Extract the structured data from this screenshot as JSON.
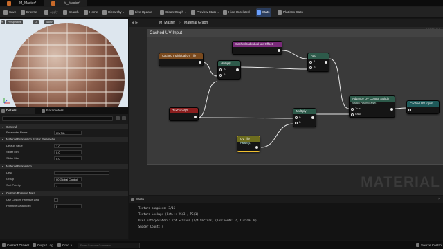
{
  "tabs": [
    {
      "label": "M_Master*",
      "active": false
    },
    {
      "label": "M_Master*",
      "active": true
    }
  ],
  "toolbar": {
    "items": [
      {
        "label": "Save",
        "icon": "save-icon",
        "enabled": true
      },
      {
        "label": "Browse",
        "icon": "browse-icon",
        "enabled": true
      },
      {
        "label": "Apply",
        "icon": "apply-icon",
        "enabled": false
      },
      {
        "label": "Search",
        "icon": "search-icon",
        "enabled": true
      },
      {
        "label": "Home",
        "icon": "home-icon",
        "enabled": true
      },
      {
        "label": "Hierarchy",
        "icon": "hierarchy-icon",
        "enabled": true,
        "dropdown": true
      },
      {
        "label": "Live Update",
        "icon": "live-update-icon",
        "enabled": true,
        "dropdown": true
      },
      {
        "label": "Clean Graph",
        "icon": "clean-graph-icon",
        "enabled": true,
        "dropdown": true
      },
      {
        "label": "Preview Stats",
        "icon": "preview-stats-icon",
        "enabled": true,
        "dropdown": true
      },
      {
        "label": "Hide Unrelated",
        "icon": "hide-unrelated-icon",
        "enabled": true
      },
      {
        "label": "Stats",
        "icon": "stats-icon",
        "enabled": true,
        "selected": true
      },
      {
        "label": "Platform Stats",
        "icon": "platform-stats-icon",
        "enabled": true
      }
    ]
  },
  "viewport": {
    "buttons": [
      "Perspective",
      "Lit",
      "Show"
    ]
  },
  "panel_tabs": [
    {
      "label": "Details",
      "active": true
    },
    {
      "label": "Parameters",
      "active": false
    }
  ],
  "details": {
    "sections": {
      "general": "General",
      "scalar": "Material Expression Scalar Parameter",
      "expression": "Material Expression",
      "primitive": "Custom Primitive Data"
    },
    "rows": {
      "param_name": {
        "label": "Parameter Name",
        "value": "UV Tile"
      },
      "default": {
        "label": "Default Value",
        "value": "1.0"
      },
      "slider_min": {
        "label": "Slider Min",
        "value": "0.0"
      },
      "slider_max": {
        "label": "Slider Max",
        "value": "0.0"
      },
      "desc": {
        "label": "Desc",
        "value": ""
      },
      "group": {
        "label": "Group",
        "value": "00 Global Control"
      },
      "sort": {
        "label": "Sort Priority",
        "value": "1"
      },
      "use_cpd": {
        "label": "Use Custom Primitive Data",
        "value": ""
      },
      "cpd_index": {
        "label": "Primitive Data Index",
        "value": "0"
      }
    }
  },
  "graph": {
    "breadcrumb_root": "M_Master",
    "breadcrumb_sep": "›",
    "breadcrumb_current": "Material Graph",
    "zoom": "Zoom 1:1",
    "comment": "Cached UV Input",
    "watermark": "MATERIAL",
    "nodes": {
      "uv_tile_cached": {
        "title": "Cached Individual UV Tile",
        "color": "#7a4a1e"
      },
      "uv_offset_cached": {
        "title": "Cached Individual UV Offset",
        "color": "#7a2a7a"
      },
      "multiply1": {
        "title": "Multiply",
        "color": "#2d5a4a",
        "pin_a": "A",
        "pin_b": "B"
      },
      "add": {
        "title": "Add",
        "color": "#2d5a4a",
        "pin_a": "A",
        "pin_b": "B"
      },
      "texcoord": {
        "title": "TexCoord[0]",
        "color": "#8a1e1e"
      },
      "multiply2": {
        "title": "Multiply",
        "color": "#2d5a4a",
        "pin_a": "A",
        "pin_b": "B"
      },
      "uv_tile": {
        "title": "UV Tile",
        "sub": "Param (1)",
        "color": "#6d6d1e"
      },
      "switch": {
        "title": "Advance UV Control Switch",
        "sub": "Switch Param (False)",
        "color": "#2d5a4a",
        "pin_true": "True",
        "pin_false": "False"
      },
      "uv_input": {
        "title": "Cached UV Input",
        "color": "#1e5a5a"
      }
    }
  },
  "stats": {
    "title": "Stats",
    "lines": [
      "Texture samplers: 3/16",
      "Texture Lookups (Est.): VS(3), PS(1)",
      "User interpolators: 2/4 Scalars (1/4 Vectors) (TexCoords: 2, Custom: 0)",
      "Shader Count: 4"
    ]
  },
  "statusbar": {
    "content_drawer": "Content Drawer",
    "output_log": "Output Log",
    "cmd": "Cmd",
    "cmd_placeholder": "Enter Console Command",
    "source_control": "Source Control"
  }
}
